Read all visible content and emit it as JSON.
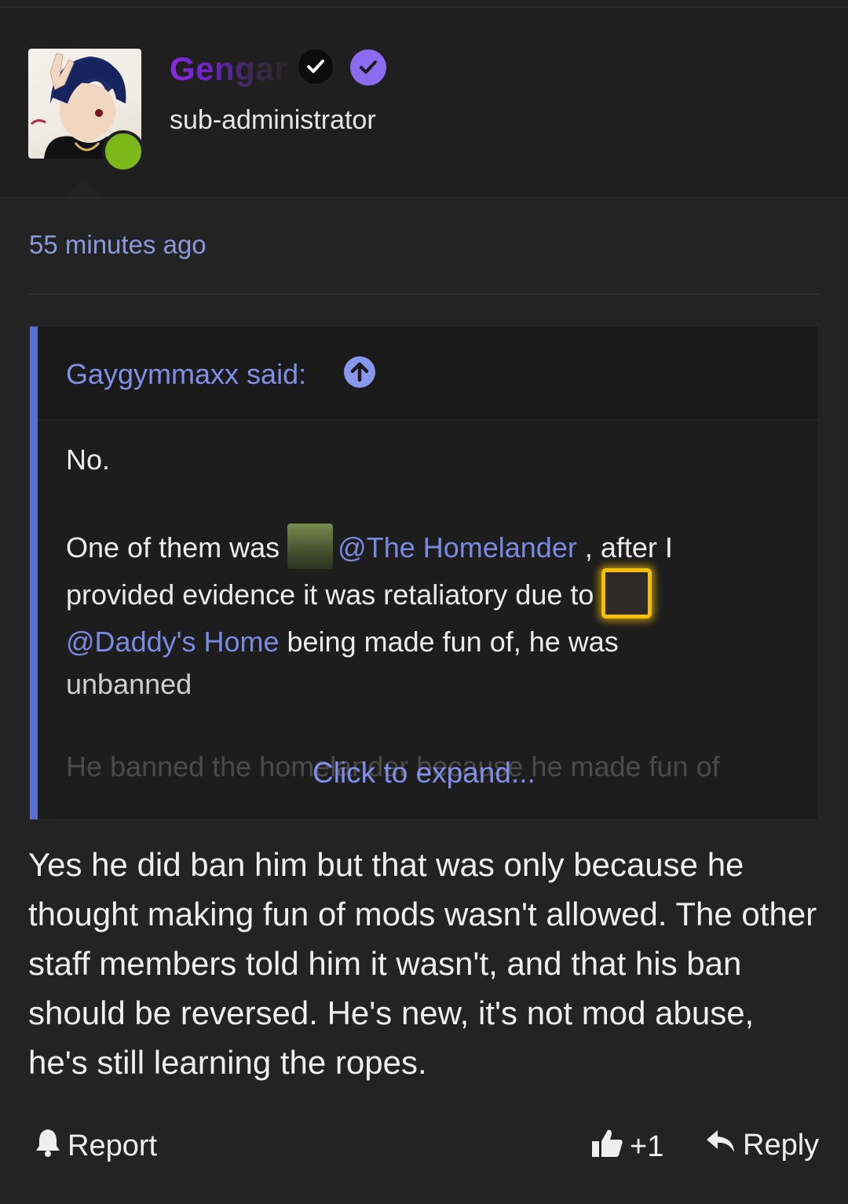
{
  "post": {
    "author": {
      "username": "Gengar",
      "user_title": "sub-administrator",
      "status": "online"
    },
    "timestamp": "55 minutes ago",
    "quote": {
      "author_label": "Gaygymmaxx said:",
      "line1": "No.",
      "line2_prefix": "One of them was",
      "mention1": "@The Homelander",
      "line2_suffix": ", after I",
      "line3": "provided evidence it was retaliatory due to",
      "mention2": "@Daddy's Home",
      "line4_suffix": " being made fun of, he was",
      "line5": "unbanned",
      "faded_line": "He banned the homelander because he made fun of",
      "expand_label": "Click to expand..."
    },
    "body": "Yes he did ban him but that was only because he thought making fun of mods wasn't allowed. The other staff members told him it wasn't, and that his ban should be reversed. He's new, it's not mod abuse, he's still learning the ropes.",
    "actions": {
      "report": "Report",
      "like_count": "+1",
      "reply": "Reply"
    },
    "colors": {
      "accent": "#7b8ae0",
      "quote_bar": "#5b6fd3",
      "online": "#7cb81a",
      "username_gradient_start": "#8a2be2",
      "verified_badge": "#8b6cf0",
      "mention_highlight": "#f5c000"
    },
    "icons": [
      "verified-black-icon",
      "verified-purple-icon",
      "arrow-up-circle-icon",
      "bell-icon",
      "thumbs-up-icon",
      "reply-arrow-icon"
    ]
  }
}
